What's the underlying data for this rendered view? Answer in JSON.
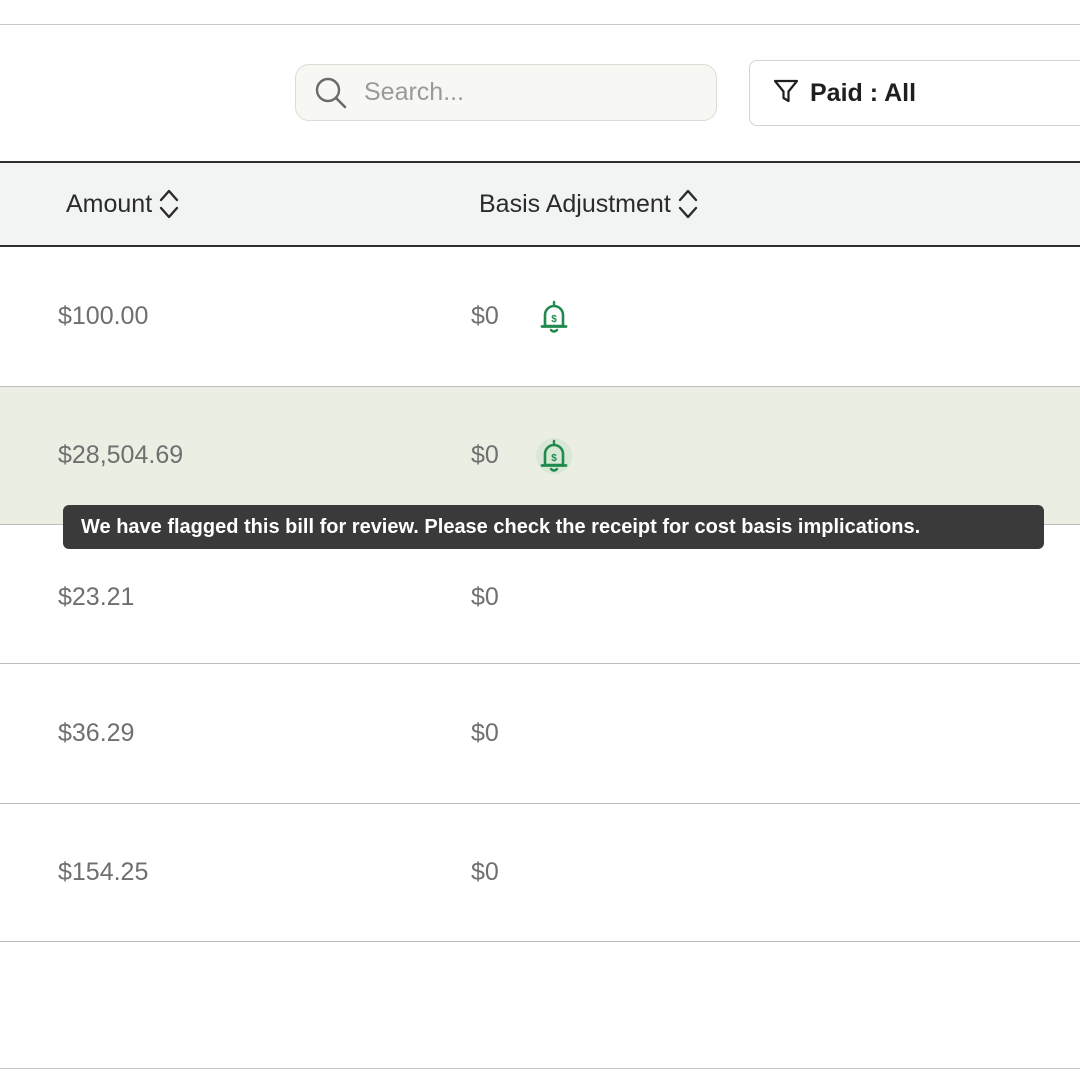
{
  "toolbar": {
    "search_placeholder": "Search...",
    "filter_label": "Paid : All"
  },
  "table": {
    "columns": [
      "Amount",
      "Basis Adjustment"
    ],
    "rows": [
      {
        "amount": "$100.00",
        "basis": "$0",
        "flagged": true
      },
      {
        "amount": "$28,504.69",
        "basis": "$0",
        "flagged": true,
        "highlighted": true
      },
      {
        "amount": "$23.21",
        "basis": "$0",
        "flagged": false
      },
      {
        "amount": "$36.29",
        "basis": "$0",
        "flagged": false
      },
      {
        "amount": "$154.25",
        "basis": "$0",
        "flagged": false
      }
    ]
  },
  "tooltip": {
    "text": "We have flagged this bill for review. Please check the receipt for cost basis implications."
  },
  "icons": {
    "search": "search-icon",
    "filter": "filter-icon",
    "sort": "sort-icon",
    "flag_bell": "dollar-bell-icon"
  },
  "colors": {
    "accent_green": "#1f8a4c",
    "highlight_row": "#eaeee3",
    "tooltip_bg": "#3a3a3a"
  }
}
